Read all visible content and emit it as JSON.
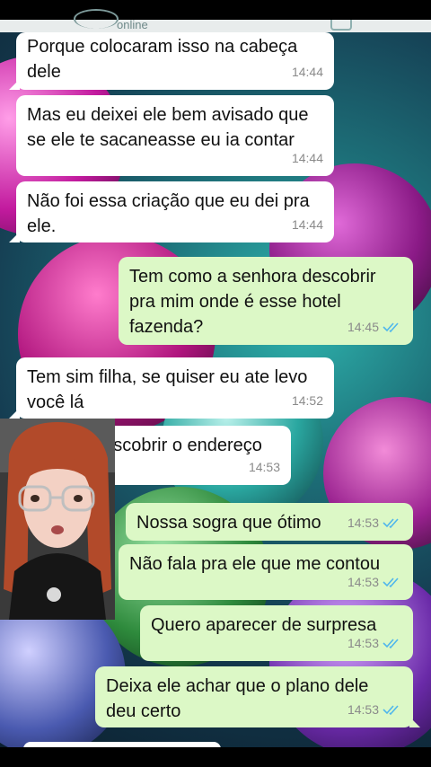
{
  "header": {
    "status": "online"
  },
  "messages": [
    {
      "id": "m1",
      "direction": "incoming",
      "text": "Porque colocaram isso na cabeça\ndele",
      "time": "14:44"
    },
    {
      "id": "m2",
      "direction": "incoming",
      "text": "Mas eu deixei ele bem avisado que\nse ele te sacaneasse eu ia contar",
      "time": "14:44"
    },
    {
      "id": "m3",
      "direction": "incoming",
      "text": "Não foi essa criação que eu dei pra\nele.",
      "time": "14:44"
    },
    {
      "id": "m4",
      "direction": "outgoing",
      "text": "Tem como a senhora descobrir\npra mim onde é esse hotel\nfazenda?",
      "time": "14:45",
      "status": "read"
    },
    {
      "id": "m5",
      "direction": "incoming",
      "text": "Tem sim filha, se quiser eu ate levo\nvocê lá",
      "time": "14:52"
    },
    {
      "id": "m6",
      "direction": "incoming",
      "text": "descobrir o endereço",
      "time": "14:53"
    },
    {
      "id": "m7",
      "direction": "outgoing",
      "text": "Nossa sogra que ótimo",
      "time": "14:53",
      "status": "read"
    },
    {
      "id": "m8",
      "direction": "outgoing",
      "text": "Não fala pra ele que me contou",
      "time": "14:53",
      "status": "read"
    },
    {
      "id": "m9",
      "direction": "outgoing",
      "text": "Quero aparecer de surpresa",
      "time": "14:53",
      "status": "read"
    },
    {
      "id": "m10",
      "direction": "outgoing",
      "text": "Deixa ele achar que o plano dele\ndeu certo",
      "time": "14:53",
      "status": "read"
    }
  ],
  "colors": {
    "incoming_bubble": "#ffffff",
    "outgoing_bubble": "#dcf8c6",
    "read_ticks": "#4fb6ec",
    "timestamp": "#8a8a8a"
  },
  "icons": {
    "read_receipt": "double-check-icon"
  }
}
